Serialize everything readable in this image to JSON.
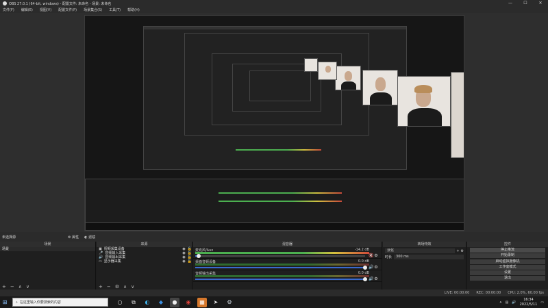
{
  "window": {
    "title": "OBS 27.0.1 (64-bit, windows) - 配置文件: 未命名 - 场景: 未命名",
    "minimize": "—",
    "maximize": "☐",
    "close": "✕"
  },
  "menu": [
    "文件(F)",
    "编辑(E)",
    "视图(V)",
    "配置文件(P)",
    "场景集合(S)",
    "工具(T)",
    "帮助(H)"
  ],
  "dock": {
    "source_status": "未选择源",
    "properties_label": "属性",
    "filters_label": "滤镜"
  },
  "scenes": {
    "header": "场景",
    "items": [
      "场景"
    ],
    "foot_add": "+",
    "foot_remove": "−",
    "foot_up": "∧",
    "foot_down": "∨"
  },
  "sources": {
    "header": "来源",
    "items": [
      {
        "icon": "camera-icon",
        "glyph": "▣",
        "label": "视频采集设备"
      },
      {
        "icon": "microphone-icon",
        "glyph": "🎤",
        "label": "音频输入采集"
      },
      {
        "icon": "speaker-icon",
        "glyph": "🔊",
        "label": "音频输出采集"
      },
      {
        "icon": "monitor-icon",
        "glyph": "▭",
        "label": "显示器采集"
      }
    ],
    "foot_add": "+",
    "foot_remove": "−",
    "foot_settings": "⚙",
    "foot_up": "∧",
    "foot_down": "∨"
  },
  "mixer": {
    "header": "混音器",
    "tracks": [
      {
        "name": "麦克风/Aux",
        "db": "-14.2 dB",
        "level": 0.8,
        "fader": 0.02
      },
      {
        "name": "桌面音频设备",
        "db": "0.0 dB",
        "level": 0.0,
        "fader": 1.0
      },
      {
        "name": "音频输出采集",
        "db": "0.0 dB",
        "level": 0.0,
        "fader": 1.0
      }
    ]
  },
  "transitions": {
    "header": "转场特效",
    "type": "淡化",
    "duration_label": "时长",
    "duration_value": "300 ms"
  },
  "controls": {
    "header": "控件",
    "buttons": [
      "停止推流",
      "开始录制",
      "启动虚拟摄像机",
      "工作室模式",
      "设置",
      "退出"
    ]
  },
  "status": {
    "live": "LIVE: 00:00:00",
    "rec": "REC: 00:00:00",
    "cpu": "CPU: 2.0%, 60.00 fps"
  },
  "taskbar": {
    "search_placeholder": "在这里输入你要搜索的内容",
    "time": "16:34",
    "date": "2022/5/11"
  },
  "colors": {
    "accent_blue": "#3a6ad0",
    "meter_green": "#4caf50",
    "meter_yellow": "#d6c13e",
    "meter_red": "#d04a3a"
  }
}
